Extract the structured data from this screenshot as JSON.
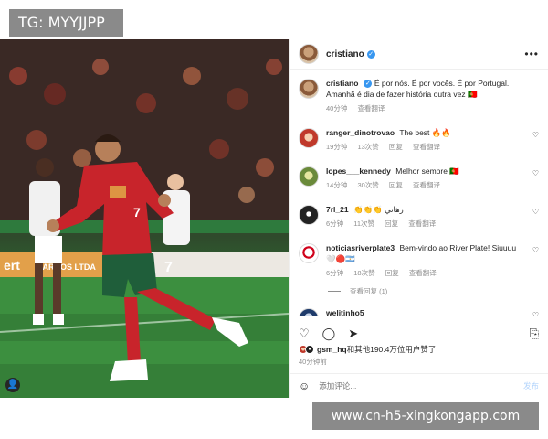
{
  "watermark_top": "TG: MYYJJPP",
  "watermark_bottom": "www.cn-h5-xingkongapp.com",
  "post": {
    "username": "cristiano",
    "caption_user": "cristiano",
    "caption": "É por nós. É por vocês. É por Portugal. Amanhã é dia de fazer história outra vez 🇵🇹",
    "caption_time": "40分钟",
    "caption_translate": "查看翻译",
    "more_icon": "more-horizontal-icon"
  },
  "comments": [
    {
      "user": "ranger_dinotrovao",
      "text": "The best 🔥🔥",
      "time": "19分钟",
      "likes": "13次赞",
      "reply": "回复",
      "translate": "查看翻译"
    },
    {
      "user": "lopes___kennedy",
      "text": "Melhor sempre 🇵🇹",
      "time": "14分钟",
      "likes": "30次赞",
      "reply": "回复",
      "translate": "查看翻译"
    },
    {
      "user": "7rl_21",
      "text": "👏👏👏 رهاني",
      "time": "6分钟",
      "likes": "11次赞",
      "reply": "回复",
      "translate": "查看翻译"
    },
    {
      "user": "noticiasriverplate3",
      "text": "Bem-vindo ao River Plate! Siuuuu 🤍🔴🇦🇷",
      "time": "6分钟",
      "likes": "18次赞",
      "reply": "回复",
      "translate": "查看翻译"
    }
  ],
  "view_replies": "查看回复 (1)",
  "last_comment_user": "welitinho5",
  "likes_line": {
    "user": "gsm_hq",
    "rest": "和其他190.4万位用户赞了"
  },
  "post_time": "40分钟前",
  "add_comment_placeholder": "添加评论...",
  "post_button": "发布",
  "colors": {
    "verified": "#3897f0",
    "post_disabled": "#b3d4fc",
    "jersey_red": "#c8242b",
    "shorts_green": "#1f5e3a"
  }
}
